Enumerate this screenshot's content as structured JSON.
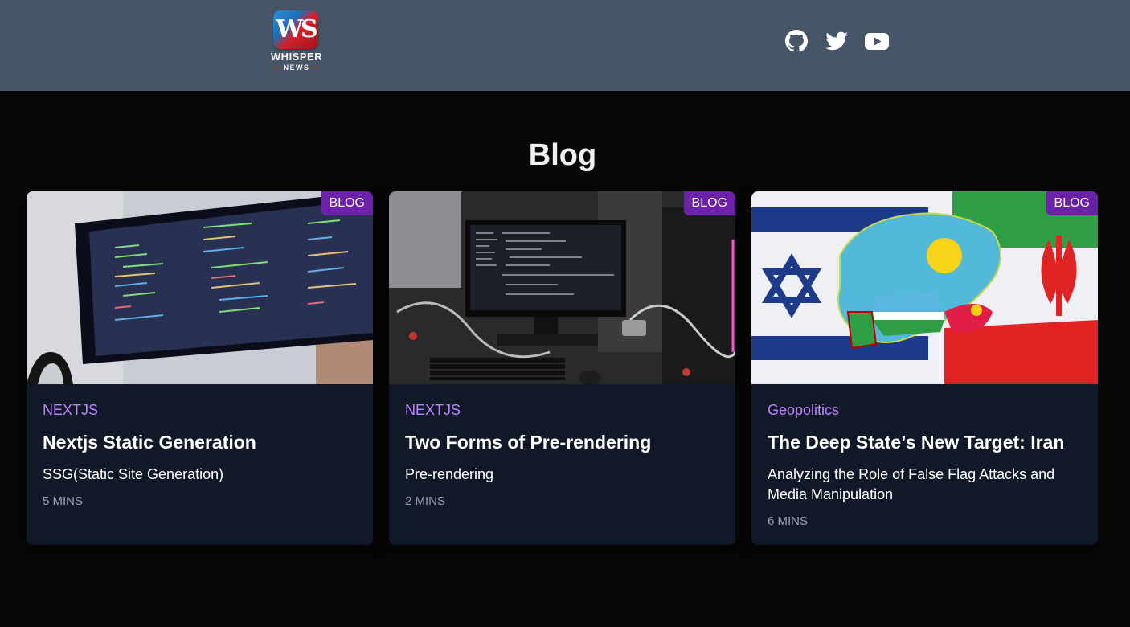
{
  "header": {
    "logo": {
      "title": "WHISPER",
      "subtitle": "NEWS",
      "mark": "WS"
    },
    "social": [
      {
        "name": "github-icon",
        "label": "GitHub"
      },
      {
        "name": "twitter-icon",
        "label": "Twitter"
      },
      {
        "name": "youtube-icon",
        "label": "YouTube"
      }
    ]
  },
  "page": {
    "title": "Blog"
  },
  "colors": {
    "header_bg": "#475569",
    "page_bg": "#070707",
    "card_bg": "#111827",
    "badge_bg": "#6b21a8",
    "category": "#c084fc",
    "meta": "#9ca3af"
  },
  "posts": [
    {
      "badge": "BLOG",
      "category": "NEXTJS",
      "title": "Nextjs Static Generation",
      "description": "SSG(Static Site Generation)",
      "read_time": "5 MINS",
      "image": "monitor-code-photo"
    },
    {
      "badge": "BLOG",
      "category": "NEXTJS",
      "title": "Two Forms of Pre-rendering",
      "description": "Pre-rendering",
      "read_time": "2 MINS",
      "image": "computer-workstation-photo"
    },
    {
      "badge": "BLOG",
      "category": "Geopolitics",
      "title": "The Deep State’s New Target: Iran",
      "description": "Analyzing the Role of False Flag Attacks and Media Manipulation",
      "read_time": "6 MINS",
      "image": "flags-map-photo"
    }
  ]
}
